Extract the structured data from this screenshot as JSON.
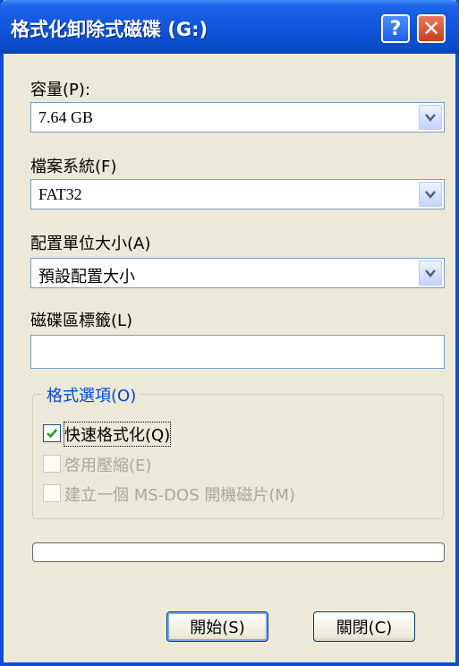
{
  "window": {
    "title": "格式化卸除式磁碟 (G:)",
    "help_icon": "?",
    "close_icon": "✕"
  },
  "capacity": {
    "label": "容量(P):",
    "value": "7.64 GB"
  },
  "file_system": {
    "label": "檔案系統(F)",
    "value": "FAT32"
  },
  "allocation_unit": {
    "label": "配置單位大小(A)",
    "value": "預設配置大小"
  },
  "volume_label": {
    "label": "磁碟區標籤(L)",
    "value": ""
  },
  "format_options": {
    "title": "格式選項(O)",
    "quick_format": {
      "label": "快速格式化(Q)",
      "checked": true,
      "enabled": true
    },
    "enable_compression": {
      "label": "啓用壓縮(E)",
      "checked": false,
      "enabled": false
    },
    "ms_dos_startup": {
      "label": "建立一個 MS-DOS 開機磁片(M)",
      "checked": false,
      "enabled": false
    }
  },
  "progress": {
    "value": 0
  },
  "buttons": {
    "start": "開始(S)",
    "close": "關閉(C)"
  },
  "colors": {
    "titlebar": "#0a4bc8",
    "group_title": "#0046d5",
    "dialog_bg": "#ece9d8"
  }
}
